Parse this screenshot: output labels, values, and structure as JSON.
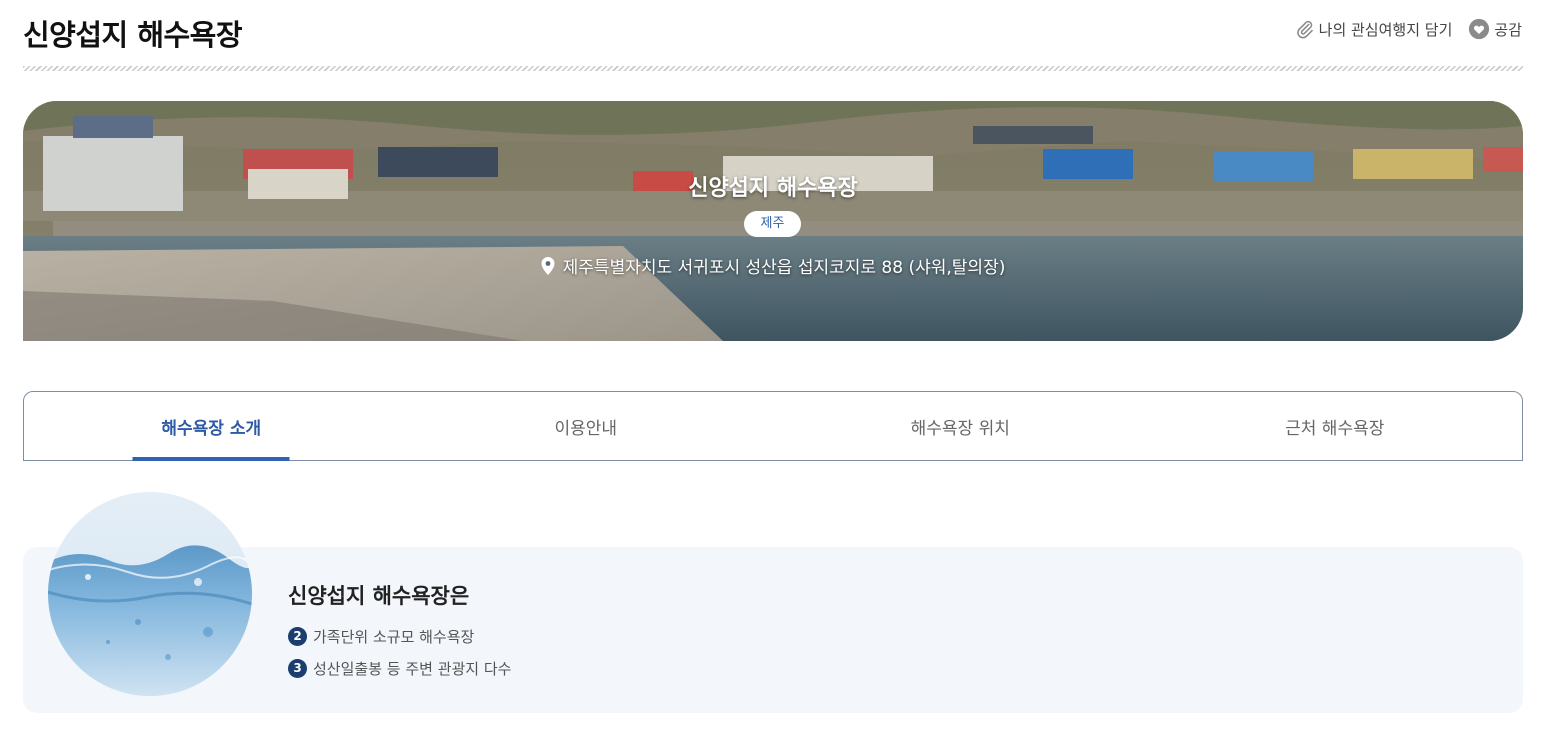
{
  "page": {
    "title": "신양섭지 해수욕장"
  },
  "actions": {
    "bookmark_label": "나의 관심여행지 담기",
    "like_label": "공감"
  },
  "hero": {
    "title": "신양섭지 해수욕장",
    "region_badge": "제주",
    "address": "제주특별자치도 서귀포시 성산읍 섭지코지로 88 (샤워,탈의장)"
  },
  "tabs": [
    {
      "label": "해수욕장 소개",
      "active": true
    },
    {
      "label": "이용안내",
      "active": false
    },
    {
      "label": "해수욕장 위치",
      "active": false
    },
    {
      "label": "근처 해수욕장",
      "active": false
    }
  ],
  "intro": {
    "heading": "신양섭지 해수욕장은",
    "items": [
      {
        "num": "2",
        "text": "가족단위 소규모 해수욕장"
      },
      {
        "num": "3",
        "text": "성산일출봉 등 주변 관광지 다수"
      }
    ]
  },
  "colors": {
    "accent": "#2e5aa6",
    "badge_dark": "#1b3e6e",
    "card_bg": "#f3f7fb"
  }
}
